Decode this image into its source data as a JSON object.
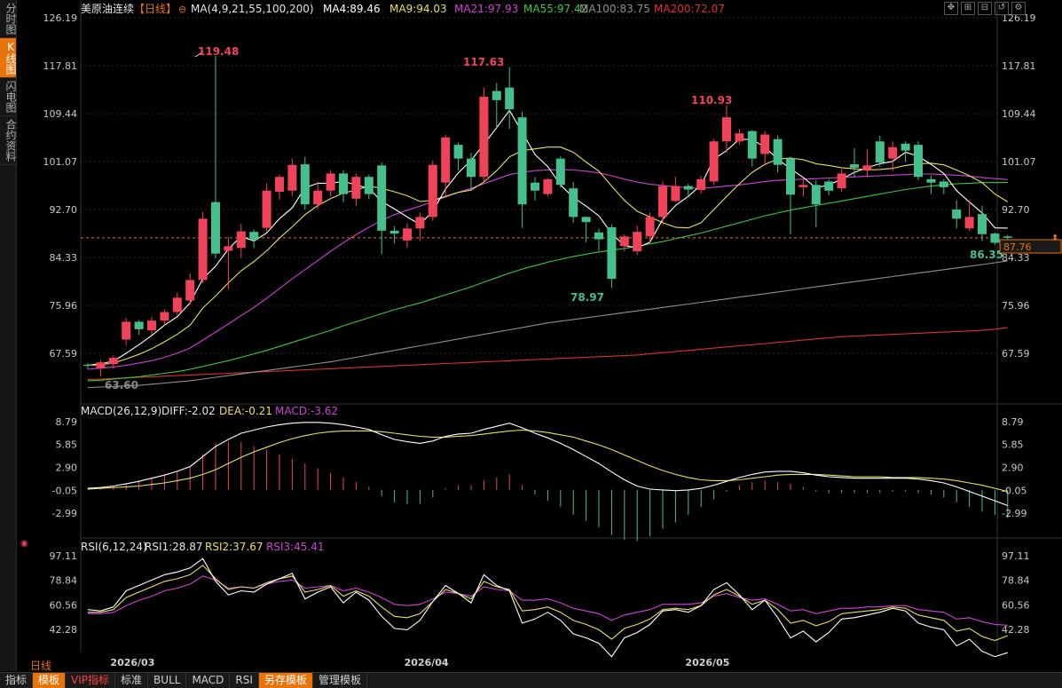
{
  "sidebar": {
    "tabs": [
      {
        "label": "分时图",
        "active": false
      },
      {
        "label": "K线图",
        "active": true
      },
      {
        "label": "闪电图",
        "active": false
      },
      {
        "label": "合约资料",
        "active": false
      }
    ]
  },
  "header": {
    "name": "美原油连续",
    "period": "【日线】",
    "ma_params": "MA(4,9,21,55,100,200)",
    "ma4": "MA4:89.46",
    "ma9": "MA9:94.03",
    "ma21": "MA21:97.93",
    "ma55": "MA55:97.42",
    "ma100": "MA100:83.75",
    "ma200": "MA200:72.07"
  },
  "colors": {
    "up": "#f0435a",
    "down": "#45c08c",
    "ma4": "#ffffff",
    "ma9": "#e8e060",
    "ma21": "#d040d8",
    "ma55": "#3cc83c",
    "ma100": "#909090",
    "ma200": "#e03030",
    "grid": "#2a2a2a",
    "price_line": "#e8730a"
  },
  "price_axis": {
    "ticks": [
      "126.19",
      "117.81",
      "109.44",
      "101.07",
      "92.70",
      "84.33",
      "75.96",
      "67.59"
    ],
    "current_price": "87.76"
  },
  "annotations": {
    "high1": "119.48",
    "high2": "117.63",
    "high3": "110.93",
    "low1": "63.60",
    "low2": "78.97",
    "last_low": "86.35"
  },
  "macd": {
    "title": "MACD(26,12,9)",
    "diff": "DIFF:-2.02",
    "dea": "DEA:-0.21",
    "macd": "MACD:-3.62",
    "ticks": [
      "8.79",
      "5.85",
      "2.90",
      "-0.05",
      "-2.99"
    ]
  },
  "rsi": {
    "title": "RSI(6,12,24)",
    "rsi1": "RSI1:28.87",
    "rsi2": "RSI2:37.67",
    "rsi3": "RSI3:45.41",
    "ticks": [
      "97.11",
      "78.84",
      "60.56",
      "42.28"
    ]
  },
  "x_axis": {
    "labels": [
      "2026/03",
      "2026/04",
      "2026/05"
    ]
  },
  "footer": {
    "period_label": "日线",
    "tabs": [
      {
        "label": "指标",
        "style": "normal"
      },
      {
        "label": "模板",
        "style": "orange"
      },
      {
        "label": "VIP指标",
        "style": "redtext"
      },
      {
        "label": "标准",
        "style": "normal"
      },
      {
        "label": "BULL",
        "style": "normal"
      },
      {
        "label": "MACD",
        "style": "normal"
      },
      {
        "label": "RSI",
        "style": "normal"
      },
      {
        "label": "另存模板",
        "style": "orange"
      },
      {
        "label": "管理模板",
        "style": "normal"
      }
    ]
  },
  "toolbar_icons": [
    "move-icon",
    "zoom-in-icon",
    "zoom-out-icon",
    "refresh-icon",
    "settings-icon"
  ],
  "chart_data": {
    "type": "candlestick",
    "candles": [
      [
        65.6,
        65.4,
        64.8,
        65.9
      ],
      [
        65.0,
        66.0,
        63.6,
        66.4
      ],
      [
        65.7,
        66.8,
        64.9,
        67.2
      ],
      [
        70.0,
        73.1,
        69.0,
        73.8
      ],
      [
        73.1,
        71.8,
        70.8,
        73.4
      ],
      [
        71.6,
        73.3,
        70.9,
        74.0
      ],
      [
        73.3,
        74.8,
        72.5,
        75.3
      ],
      [
        74.8,
        77.3,
        74.2,
        78.2
      ],
      [
        76.8,
        80.4,
        76.0,
        81.6
      ],
      [
        80.4,
        91.1,
        79.8,
        92.3
      ],
      [
        94.0,
        85.0,
        84.2,
        119.5
      ],
      [
        85.5,
        86.3,
        78.8,
        87.9
      ],
      [
        86.0,
        88.9,
        84.2,
        90.2
      ],
      [
        88.8,
        87.4,
        86.0,
        89.2
      ],
      [
        89.5,
        96.0,
        88.8,
        97.3
      ],
      [
        95.8,
        98.4,
        94.4,
        98.8
      ],
      [
        96.0,
        100.5,
        95.0,
        101.6
      ],
      [
        100.6,
        93.6,
        92.7,
        101.9
      ],
      [
        93.6,
        96.0,
        92.8,
        97.6
      ],
      [
        96.0,
        99.0,
        95.0,
        99.6
      ],
      [
        99.0,
        95.4,
        94.0,
        99.6
      ],
      [
        94.6,
        98.4,
        93.3,
        99.0
      ],
      [
        98.4,
        95.4,
        94.5,
        98.8
      ],
      [
        100.4,
        89.0,
        84.9,
        100.9
      ],
      [
        89.0,
        88.5,
        86.8,
        89.8
      ],
      [
        87.3,
        89.4,
        86.0,
        90.3
      ],
      [
        89.4,
        91.4,
        87.3,
        92.2
      ],
      [
        91.4,
        100.5,
        90.7,
        101.2
      ],
      [
        97.4,
        105.3,
        95.2,
        105.8
      ],
      [
        104.0,
        101.6,
        99.5,
        104.4
      ],
      [
        101.6,
        98.4,
        96.0,
        102.6
      ],
      [
        98.4,
        112.4,
        97.6,
        114.0
      ],
      [
        113.4,
        111.8,
        107.0,
        114.8
      ],
      [
        114.0,
        110.2,
        106.8,
        117.6
      ],
      [
        108.8,
        93.6,
        89.5,
        109.8
      ],
      [
        97.4,
        96.0,
        94.3,
        98.4
      ],
      [
        95.4,
        98.0,
        95.0,
        98.2
      ],
      [
        101.6,
        97.0,
        96.5,
        102.0
      ],
      [
        96.4,
        91.4,
        90.4,
        97.5
      ],
      [
        91.4,
        90.5,
        87.0,
        91.5
      ],
      [
        88.7,
        87.5,
        85.5,
        89.4
      ],
      [
        89.6,
        80.6,
        78.97,
        90.1
      ],
      [
        86.3,
        88.0,
        85.4,
        88.4
      ],
      [
        85.4,
        88.8,
        84.8,
        89.9
      ],
      [
        88.0,
        91.4,
        87.0,
        92.2
      ],
      [
        91.4,
        96.8,
        90.0,
        97.6
      ],
      [
        94.2,
        96.8,
        94.0,
        98.4
      ],
      [
        96.8,
        96.2,
        95.0,
        97.2
      ],
      [
        96.1,
        98.0,
        95.5,
        98.6
      ],
      [
        97.6,
        104.6,
        97.0,
        105.0
      ],
      [
        104.6,
        108.8,
        102.6,
        110.9
      ],
      [
        104.6,
        106.0,
        104.0,
        106.8
      ],
      [
        106.4,
        101.6,
        100.2,
        106.6
      ],
      [
        102.4,
        105.8,
        100.7,
        106.4
      ],
      [
        105.0,
        100.5,
        99.2,
        105.6
      ],
      [
        101.6,
        95.3,
        88.4,
        101.9
      ],
      [
        96.6,
        97.0,
        95.0,
        98.2
      ],
      [
        97.0,
        93.6,
        89.6,
        97.8
      ],
      [
        97.6,
        96.0,
        95.2,
        98.0
      ],
      [
        96.4,
        99.0,
        95.8,
        99.8
      ],
      [
        100.6,
        100.0,
        98.4,
        103.4
      ],
      [
        99.6,
        100.4,
        98.6,
        103.2
      ],
      [
        104.6,
        100.9,
        100.2,
        105.6
      ],
      [
        101.6,
        103.6,
        99.4,
        104.6
      ],
      [
        104.2,
        103.0,
        101.0,
        104.6
      ],
      [
        104.0,
        98.4,
        97.8,
        104.6
      ],
      [
        98.0,
        97.4,
        95.4,
        98.6
      ],
      [
        97.6,
        96.6,
        95.4,
        98.0
      ],
      [
        92.7,
        91.1,
        89.4,
        94.3
      ],
      [
        89.4,
        91.4,
        89.0,
        94.3
      ],
      [
        91.9,
        88.4,
        87.2,
        93.4
      ],
      [
        88.5,
        86.9,
        86.5,
        88.7
      ],
      [
        88.0,
        87.76,
        86.35,
        88.3
      ]
    ],
    "ma_lines": {
      "ma4": [
        65.5,
        65.8,
        66.2,
        67.6,
        69.1,
        70.7,
        72.5,
        74.0,
        76.4,
        80.6,
        82.8,
        85.8,
        88.0,
        87.2,
        88.6,
        91.1,
        93.0,
        96.5,
        97.3,
        97.3,
        97.6,
        97.0,
        96.4,
        94.1,
        92.8,
        91.4,
        90.1,
        92.4,
        96.3,
        99.1,
        101.3,
        104.1,
        107.0,
        110.0,
        106.2,
        102.3,
        100.2,
        97.0,
        94.8,
        93.3,
        91.6,
        88.5,
        86.4,
        86.0,
        87.0,
        91.0,
        93.4,
        95.0,
        97.0,
        101.5,
        103.0,
        105.0,
        104.9,
        103.6,
        101.5,
        99.8,
        98.3,
        96.5,
        97.0,
        98.0,
        99.2,
        100.0,
        100.7,
        101.1,
        102.7,
        102.0,
        100.6,
        99.0,
        96.0,
        94.0,
        92.1,
        89.5,
        89.46
      ],
      "ma9": [
        65.5,
        65.6,
        65.9,
        66.6,
        67.4,
        68.4,
        69.6,
        70.9,
        72.5,
        75.5,
        77.6,
        79.9,
        82.0,
        83.6,
        85.5,
        87.7,
        89.7,
        91.8,
        93.4,
        94.6,
        95.6,
        96.1,
        96.8,
        96.4,
        95.8,
        95.1,
        94.1,
        94.3,
        95.0,
        95.7,
        96.1,
        97.5,
        99.5,
        101.9,
        103.0,
        103.3,
        103.6,
        103.6,
        102.7,
        101.0,
        99.4,
        96.8,
        94.3,
        92.4,
        91.4,
        90.4,
        89.6,
        89.5,
        90.4,
        92.7,
        95.0,
        97.2,
        99.2,
        100.6,
        101.5,
        101.7,
        101.4,
        100.7,
        100.4,
        100.0,
        99.8,
        99.6,
        99.7,
        99.9,
        100.4,
        100.7,
        100.8,
        100.5,
        99.6,
        98.6,
        97.4,
        95.4,
        94.03
      ],
      "ma21": [
        64.8,
        65.0,
        65.2,
        65.5,
        65.9,
        66.3,
        66.9,
        67.6,
        68.5,
        69.9,
        71.3,
        72.7,
        74.2,
        75.6,
        77.2,
        78.9,
        80.6,
        82.2,
        83.8,
        85.4,
        86.9,
        88.3,
        89.6,
        90.8,
        91.8,
        92.6,
        93.3,
        94.1,
        94.9,
        95.7,
        96.4,
        97.2,
        98.0,
        98.8,
        99.2,
        99.5,
        99.6,
        99.7,
        99.6,
        99.4,
        99.1,
        98.6,
        98.0,
        97.5,
        97.1,
        96.9,
        96.7,
        96.5,
        96.4,
        96.6,
        96.8,
        97.0,
        97.3,
        97.6,
        97.8,
        97.9,
        98.0,
        98.1,
        98.2,
        98.3,
        98.4,
        98.5,
        98.6,
        98.7,
        98.8,
        98.9,
        98.9,
        98.8,
        98.7,
        98.5,
        98.3,
        98.1,
        97.93
      ],
      "ma55": [
        62.8,
        62.9,
        63.1,
        63.3,
        63.5,
        63.8,
        64.1,
        64.4,
        64.8,
        65.3,
        65.8,
        66.3,
        66.9,
        67.5,
        68.1,
        68.8,
        69.5,
        70.2,
        70.9,
        71.6,
        72.4,
        73.1,
        73.8,
        74.5,
        75.2,
        75.8,
        76.4,
        77.1,
        77.8,
        78.5,
        79.2,
        80.0,
        80.8,
        81.6,
        82.3,
        82.9,
        83.5,
        84.0,
        84.5,
        84.9,
        85.3,
        85.6,
        85.9,
        86.3,
        86.7,
        87.1,
        87.6,
        88.1,
        88.6,
        89.2,
        89.8,
        90.4,
        91.0,
        91.6,
        92.1,
        92.6,
        93.0,
        93.4,
        93.8,
        94.2,
        94.6,
        95.0,
        95.4,
        95.8,
        96.2,
        96.5,
        96.8,
        97.0,
        97.2,
        97.3,
        97.4,
        97.4,
        97.42
      ],
      "ma100": [
        61.6,
        61.7,
        61.8,
        61.9,
        62.0,
        62.2,
        62.4,
        62.6,
        62.8,
        63.1,
        63.4,
        63.7,
        64.0,
        64.3,
        64.6,
        64.9,
        65.2,
        65.5,
        65.8,
        66.1,
        66.5,
        66.9,
        67.3,
        67.7,
        68.1,
        68.5,
        68.9,
        69.3,
        69.7,
        70.1,
        70.5,
        70.9,
        71.3,
        71.7,
        72.1,
        72.5,
        72.9,
        73.2,
        73.5,
        73.8,
        74.1,
        74.4,
        74.7,
        75.0,
        75.3,
        75.6,
        75.9,
        76.2,
        76.5,
        76.8,
        77.1,
        77.4,
        77.7,
        78.0,
        78.3,
        78.6,
        78.9,
        79.2,
        79.5,
        79.8,
        80.1,
        80.4,
        80.7,
        81.0,
        81.3,
        81.6,
        81.9,
        82.2,
        82.5,
        82.8,
        83.1,
        83.4,
        83.75
      ],
      "ma200": [
        63.0,
        63.1,
        63.2,
        63.3,
        63.4,
        63.5,
        63.6,
        63.7,
        63.8,
        63.9,
        64.0,
        64.1,
        64.2,
        64.3,
        64.4,
        64.5,
        64.6,
        64.7,
        64.8,
        64.9,
        65.0,
        65.1,
        65.2,
        65.3,
        65.4,
        65.5,
        65.6,
        65.7,
        65.8,
        65.9,
        66.0,
        66.1,
        66.2,
        66.3,
        66.4,
        66.5,
        66.6,
        66.7,
        66.8,
        66.9,
        67.0,
        67.1,
        67.2,
        67.3,
        67.5,
        67.7,
        67.9,
        68.1,
        68.3,
        68.5,
        68.7,
        68.9,
        69.1,
        69.3,
        69.5,
        69.7,
        69.9,
        70.1,
        70.3,
        70.5,
        70.6,
        70.7,
        70.8,
        70.9,
        71.0,
        71.1,
        71.2,
        71.3,
        71.4,
        71.5,
        71.6,
        71.8,
        72.07
      ]
    },
    "macd_data": {
      "diff": [
        0.2,
        0.3,
        0.5,
        0.8,
        1.1,
        1.5,
        1.9,
        2.4,
        3.0,
        4.3,
        5.6,
        6.5,
        7.3,
        7.7,
        8.1,
        8.4,
        8.6,
        8.7,
        8.7,
        8.6,
        8.4,
        8.1,
        7.8,
        7.1,
        6.5,
        6.2,
        6.0,
        6.3,
        6.9,
        7.2,
        7.3,
        7.8,
        8.2,
        8.6,
        8.0,
        7.3,
        6.7,
        6.0,
        5.2,
        4.3,
        3.4,
        2.3,
        1.3,
        0.5,
        0.1,
        0.0,
        -0.1,
        0.0,
        0.2,
        0.6,
        1.1,
        1.6,
        2.0,
        2.3,
        2.4,
        2.4,
        2.2,
        1.9,
        1.7,
        1.6,
        1.5,
        1.5,
        1.5,
        1.5,
        1.5,
        1.4,
        1.2,
        0.9,
        0.4,
        -0.2,
        -0.8,
        -1.4,
        -2.02
      ],
      "dea": [
        0.1,
        0.2,
        0.3,
        0.4,
        0.5,
        0.7,
        0.9,
        1.2,
        1.5,
        2.0,
        2.6,
        3.4,
        4.2,
        4.9,
        5.5,
        6.1,
        6.6,
        7.0,
        7.3,
        7.5,
        7.6,
        7.6,
        7.6,
        7.5,
        7.3,
        7.1,
        6.9,
        6.8,
        6.8,
        6.9,
        7.0,
        7.2,
        7.4,
        7.6,
        7.7,
        7.6,
        7.4,
        7.1,
        6.8,
        6.3,
        5.8,
        5.2,
        4.5,
        3.8,
        3.1,
        2.5,
        2.0,
        1.6,
        1.3,
        1.2,
        1.2,
        1.3,
        1.5,
        1.7,
        1.9,
        2.0,
        2.0,
        2.0,
        1.9,
        1.8,
        1.7,
        1.7,
        1.7,
        1.6,
        1.6,
        1.6,
        1.5,
        1.4,
        1.2,
        0.9,
        0.6,
        0.2,
        -0.21
      ]
    },
    "rsi_data": {
      "rsi1": [
        57,
        56,
        59,
        71,
        75,
        79,
        83,
        85,
        88,
        95,
        78,
        68,
        71,
        70,
        76,
        80,
        84,
        65,
        70,
        74,
        62,
        70,
        64,
        52,
        43,
        42,
        49,
        63,
        75,
        69,
        62,
        83,
        75,
        71,
        47,
        50,
        55,
        49,
        39,
        36,
        32,
        22,
        36,
        40,
        46,
        56,
        57,
        55,
        60,
        72,
        77,
        68,
        57,
        64,
        51,
        36,
        41,
        33,
        40,
        50,
        51,
        53,
        55,
        58,
        56,
        47,
        44,
        42,
        30,
        35,
        26,
        22,
        25
      ],
      "rsi2": [
        55,
        55,
        57,
        66,
        70,
        74,
        78,
        80,
        83,
        90,
        80,
        72,
        74,
        73,
        77,
        80,
        82,
        70,
        72,
        75,
        67,
        71,
        67,
        59,
        52,
        51,
        54,
        63,
        72,
        69,
        65,
        78,
        74,
        72,
        56,
        57,
        59,
        55,
        49,
        46,
        42,
        35,
        43,
        46,
        50,
        57,
        58,
        57,
        60,
        68,
        72,
        67,
        61,
        64,
        57,
        47,
        49,
        45,
        48,
        54,
        55,
        56,
        57,
        59,
        58,
        53,
        51,
        49,
        41,
        43,
        37,
        34,
        37.67
      ],
      "rsi3": [
        54,
        54,
        55,
        60,
        64,
        67,
        71,
        73,
        76,
        82,
        79,
        73,
        74,
        73,
        76,
        78,
        79,
        73,
        74,
        75,
        71,
        73,
        70,
        66,
        61,
        60,
        61,
        65,
        70,
        69,
        67,
        74,
        72,
        71,
        64,
        64,
        65,
        62,
        58,
        56,
        54,
        49,
        53,
        55,
        57,
        61,
        61,
        61,
        62,
        67,
        69,
        66,
        64,
        65,
        61,
        56,
        57,
        54,
        56,
        58,
        58,
        59,
        59,
        60,
        60,
        57,
        56,
        55,
        50,
        51,
        48,
        46,
        45.41
      ]
    }
  }
}
